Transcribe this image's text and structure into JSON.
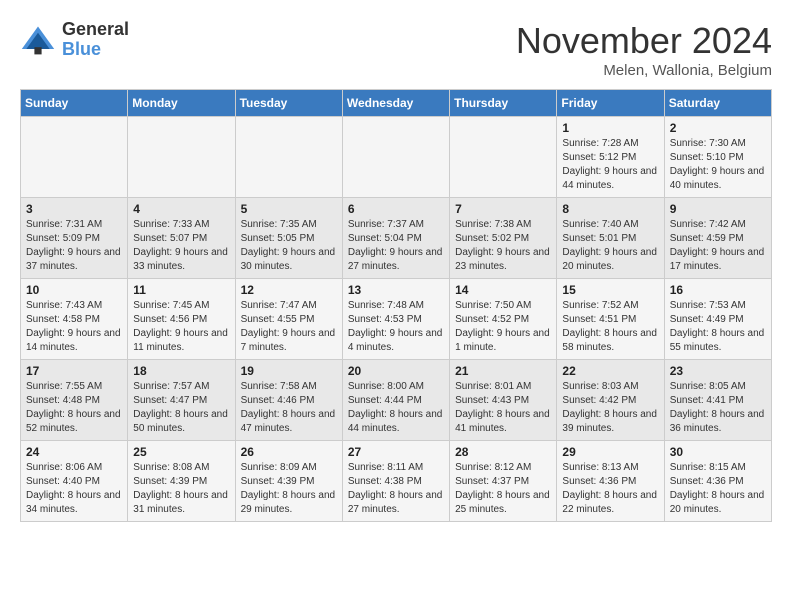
{
  "logo": {
    "general": "General",
    "blue": "Blue"
  },
  "title": "November 2024",
  "subtitle": "Melen, Wallonia, Belgium",
  "days_of_week": [
    "Sunday",
    "Monday",
    "Tuesday",
    "Wednesday",
    "Thursday",
    "Friday",
    "Saturday"
  ],
  "weeks": [
    [
      {
        "day": "",
        "info": ""
      },
      {
        "day": "",
        "info": ""
      },
      {
        "day": "",
        "info": ""
      },
      {
        "day": "",
        "info": ""
      },
      {
        "day": "",
        "info": ""
      },
      {
        "day": "1",
        "info": "Sunrise: 7:28 AM\nSunset: 5:12 PM\nDaylight: 9 hours and 44 minutes."
      },
      {
        "day": "2",
        "info": "Sunrise: 7:30 AM\nSunset: 5:10 PM\nDaylight: 9 hours and 40 minutes."
      }
    ],
    [
      {
        "day": "3",
        "info": "Sunrise: 7:31 AM\nSunset: 5:09 PM\nDaylight: 9 hours and 37 minutes."
      },
      {
        "day": "4",
        "info": "Sunrise: 7:33 AM\nSunset: 5:07 PM\nDaylight: 9 hours and 33 minutes."
      },
      {
        "day": "5",
        "info": "Sunrise: 7:35 AM\nSunset: 5:05 PM\nDaylight: 9 hours and 30 minutes."
      },
      {
        "day": "6",
        "info": "Sunrise: 7:37 AM\nSunset: 5:04 PM\nDaylight: 9 hours and 27 minutes."
      },
      {
        "day": "7",
        "info": "Sunrise: 7:38 AM\nSunset: 5:02 PM\nDaylight: 9 hours and 23 minutes."
      },
      {
        "day": "8",
        "info": "Sunrise: 7:40 AM\nSunset: 5:01 PM\nDaylight: 9 hours and 20 minutes."
      },
      {
        "day": "9",
        "info": "Sunrise: 7:42 AM\nSunset: 4:59 PM\nDaylight: 9 hours and 17 minutes."
      }
    ],
    [
      {
        "day": "10",
        "info": "Sunrise: 7:43 AM\nSunset: 4:58 PM\nDaylight: 9 hours and 14 minutes."
      },
      {
        "day": "11",
        "info": "Sunrise: 7:45 AM\nSunset: 4:56 PM\nDaylight: 9 hours and 11 minutes."
      },
      {
        "day": "12",
        "info": "Sunrise: 7:47 AM\nSunset: 4:55 PM\nDaylight: 9 hours and 7 minutes."
      },
      {
        "day": "13",
        "info": "Sunrise: 7:48 AM\nSunset: 4:53 PM\nDaylight: 9 hours and 4 minutes."
      },
      {
        "day": "14",
        "info": "Sunrise: 7:50 AM\nSunset: 4:52 PM\nDaylight: 9 hours and 1 minute."
      },
      {
        "day": "15",
        "info": "Sunrise: 7:52 AM\nSunset: 4:51 PM\nDaylight: 8 hours and 58 minutes."
      },
      {
        "day": "16",
        "info": "Sunrise: 7:53 AM\nSunset: 4:49 PM\nDaylight: 8 hours and 55 minutes."
      }
    ],
    [
      {
        "day": "17",
        "info": "Sunrise: 7:55 AM\nSunset: 4:48 PM\nDaylight: 8 hours and 52 minutes."
      },
      {
        "day": "18",
        "info": "Sunrise: 7:57 AM\nSunset: 4:47 PM\nDaylight: 8 hours and 50 minutes."
      },
      {
        "day": "19",
        "info": "Sunrise: 7:58 AM\nSunset: 4:46 PM\nDaylight: 8 hours and 47 minutes."
      },
      {
        "day": "20",
        "info": "Sunrise: 8:00 AM\nSunset: 4:44 PM\nDaylight: 8 hours and 44 minutes."
      },
      {
        "day": "21",
        "info": "Sunrise: 8:01 AM\nSunset: 4:43 PM\nDaylight: 8 hours and 41 minutes."
      },
      {
        "day": "22",
        "info": "Sunrise: 8:03 AM\nSunset: 4:42 PM\nDaylight: 8 hours and 39 minutes."
      },
      {
        "day": "23",
        "info": "Sunrise: 8:05 AM\nSunset: 4:41 PM\nDaylight: 8 hours and 36 minutes."
      }
    ],
    [
      {
        "day": "24",
        "info": "Sunrise: 8:06 AM\nSunset: 4:40 PM\nDaylight: 8 hours and 34 minutes."
      },
      {
        "day": "25",
        "info": "Sunrise: 8:08 AM\nSunset: 4:39 PM\nDaylight: 8 hours and 31 minutes."
      },
      {
        "day": "26",
        "info": "Sunrise: 8:09 AM\nSunset: 4:39 PM\nDaylight: 8 hours and 29 minutes."
      },
      {
        "day": "27",
        "info": "Sunrise: 8:11 AM\nSunset: 4:38 PM\nDaylight: 8 hours and 27 minutes."
      },
      {
        "day": "28",
        "info": "Sunrise: 8:12 AM\nSunset: 4:37 PM\nDaylight: 8 hours and 25 minutes."
      },
      {
        "day": "29",
        "info": "Sunrise: 8:13 AM\nSunset: 4:36 PM\nDaylight: 8 hours and 22 minutes."
      },
      {
        "day": "30",
        "info": "Sunrise: 8:15 AM\nSunset: 4:36 PM\nDaylight: 8 hours and 20 minutes."
      }
    ]
  ]
}
